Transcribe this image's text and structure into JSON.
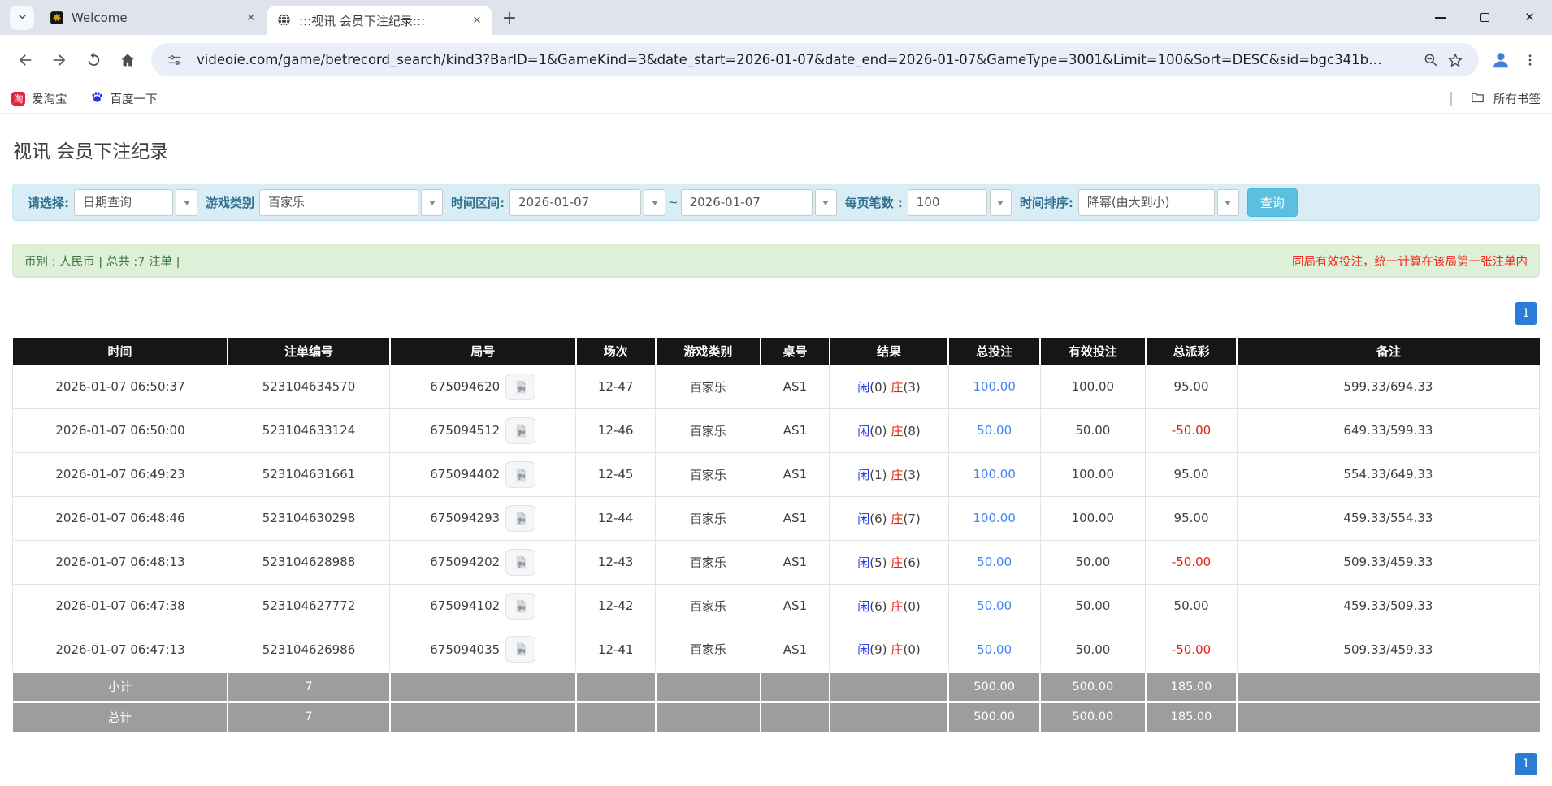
{
  "browser": {
    "tabs": [
      {
        "title": "Welcome"
      },
      {
        "title": ":::视讯 会员下注纪录:::"
      }
    ],
    "url": "videoie.com/game/betrecord_search/kind3?BarID=1&GameKind=3&date_start=2026-01-07&date_end=2026-01-07&GameType=3001&Limit=100&Sort=DESC&sid=bgc341b…",
    "bookmarks": [
      {
        "label": "爱淘宝",
        "badge": "淘"
      },
      {
        "label": "百度一下"
      }
    ],
    "all_bookmarks_label": "所有书签",
    "glyphs": {
      "tab_close": "✕",
      "new_tab": "+",
      "window_close": "✕",
      "menu_dots": "⋮"
    }
  },
  "page": {
    "title": "视讯 会员下注纪录",
    "filters": {
      "select_label": "请选择:",
      "select_value": "日期查询",
      "game_label": "游戏类别",
      "game_value": "百家乐",
      "range_label": "时间区间:",
      "date_start": "2026-01-07",
      "range_tilde": "~",
      "date_end": "2026-01-07",
      "per_page_label": "每页笔数 :",
      "per_page_value": "100",
      "sort_label": "时间排序:",
      "sort_value": "降幂(由大到小)",
      "search_button": "查询"
    },
    "summary_left": "币别 : 人民币 | 总共 :7 注单 |",
    "summary_right": "同局有效投注，统一计算在该局第一张注单内",
    "pagination": {
      "page": "1"
    },
    "table": {
      "headers": [
        "时间",
        "注单编号",
        "局号",
        "场次",
        "游戏类别",
        "桌号",
        "结果",
        "总投注",
        "有效投注",
        "总派彩",
        "备注"
      ],
      "rows": [
        {
          "time": "2026-01-07 06:50:37",
          "bet_id": "523104634570",
          "round": "675094620",
          "session": "12-47",
          "game": "百家乐",
          "table_no": "AS1",
          "result": {
            "player_label": "闲",
            "player_value": "(0)",
            "banker_label": "庄",
            "banker_value": "(3)"
          },
          "total_bet": "100.00",
          "valid_bet": "100.00",
          "payout": "95.00",
          "payout_neg": false,
          "note": "599.33/694.33"
        },
        {
          "time": "2026-01-07 06:50:00",
          "bet_id": "523104633124",
          "round": "675094512",
          "session": "12-46",
          "game": "百家乐",
          "table_no": "AS1",
          "result": {
            "player_label": "闲",
            "player_value": "(0)",
            "banker_label": "庄",
            "banker_value": "(8)"
          },
          "total_bet": "50.00",
          "valid_bet": "50.00",
          "payout": "-50.00",
          "payout_neg": true,
          "note": "649.33/599.33"
        },
        {
          "time": "2026-01-07 06:49:23",
          "bet_id": "523104631661",
          "round": "675094402",
          "session": "12-45",
          "game": "百家乐",
          "table_no": "AS1",
          "result": {
            "player_label": "闲",
            "player_value": "(1)",
            "banker_label": "庄",
            "banker_value": "(3)"
          },
          "total_bet": "100.00",
          "valid_bet": "100.00",
          "payout": "95.00",
          "payout_neg": false,
          "note": "554.33/649.33"
        },
        {
          "time": "2026-01-07 06:48:46",
          "bet_id": "523104630298",
          "round": "675094293",
          "session": "12-44",
          "game": "百家乐",
          "table_no": "AS1",
          "result": {
            "player_label": "闲",
            "player_value": "(6)",
            "banker_label": "庄",
            "banker_value": "(7)"
          },
          "total_bet": "100.00",
          "valid_bet": "100.00",
          "payout": "95.00",
          "payout_neg": false,
          "note": "459.33/554.33"
        },
        {
          "time": "2026-01-07 06:48:13",
          "bet_id": "523104628988",
          "round": "675094202",
          "session": "12-43",
          "game": "百家乐",
          "table_no": "AS1",
          "result": {
            "player_label": "闲",
            "player_value": "(5)",
            "banker_label": "庄",
            "banker_value": "(6)"
          },
          "total_bet": "50.00",
          "valid_bet": "50.00",
          "payout": "-50.00",
          "payout_neg": true,
          "note": "509.33/459.33"
        },
        {
          "time": "2026-01-07 06:47:38",
          "bet_id": "523104627772",
          "round": "675094102",
          "session": "12-42",
          "game": "百家乐",
          "table_no": "AS1",
          "result": {
            "player_label": "闲",
            "player_value": "(6)",
            "banker_label": "庄",
            "banker_value": "(0)"
          },
          "total_bet": "50.00",
          "valid_bet": "50.00",
          "payout": "50.00",
          "payout_neg": false,
          "note": "459.33/509.33"
        },
        {
          "time": "2026-01-07 06:47:13",
          "bet_id": "523104626986",
          "round": "675094035",
          "session": "12-41",
          "game": "百家乐",
          "table_no": "AS1",
          "result": {
            "player_label": "闲",
            "player_value": "(9)",
            "banker_label": "庄",
            "banker_value": "(0)"
          },
          "total_bet": "50.00",
          "valid_bet": "50.00",
          "payout": "-50.00",
          "payout_neg": true,
          "note": "509.33/459.33"
        }
      ],
      "subtotal": {
        "label": "小计",
        "count": "7",
        "total_bet": "500.00",
        "valid_bet": "500.00",
        "payout": "185.00"
      },
      "total": {
        "label": "总计",
        "count": "7",
        "total_bet": "500.00",
        "valid_bet": "500.00",
        "payout": "185.00"
      }
    }
  },
  "colors": {
    "filter_bg": "#d9edf7",
    "filter_label": "#31708f",
    "search_button_bg": "#5bc0de",
    "summary_bg": "#dff0d8",
    "summary_text": "#3c763d",
    "summary_warning_red": "#f5261b",
    "table_header_bg": "#161616",
    "table_footer_bg": "#9d9d9d",
    "bet_link_blue": "#4285f4",
    "player_blue": "#2a3cf0",
    "banker_red": "#ea1c0d",
    "negative_red": "#ea1c0d",
    "pager_blue": "#2a7cd6"
  }
}
